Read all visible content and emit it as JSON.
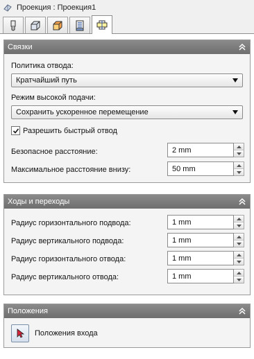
{
  "window": {
    "title": "Проекция : Проекция1"
  },
  "tabs": [
    {
      "icon": "tool-icon"
    },
    {
      "icon": "stock-box-icon"
    },
    {
      "icon": "geometry-box-icon"
    },
    {
      "icon": "heights-icon"
    },
    {
      "icon": "linking-icon",
      "active": true
    }
  ],
  "links": {
    "header": "Связки",
    "retract_policy_label": "Политика отвода:",
    "retract_policy_value": "Кратчайший путь",
    "high_feed_label": "Режим высокой подачи:",
    "high_feed_value": "Сохранить ускоренное перемещение",
    "allow_rapid_label": "Разрешить быстрый отвод",
    "allow_rapid_checked": true,
    "safe_distance_label": "Безопасное расстояние:",
    "safe_distance_value": "2 mm",
    "max_stay_down_label": "Максимальное расстояние внизу:",
    "max_stay_down_value": "50 mm"
  },
  "leads": {
    "header": "Ходы и переходы",
    "horiz_lead_in_label": "Радиус горизонтального подвода:",
    "horiz_lead_in_value": "1 mm",
    "vert_lead_in_label": "Радиус вертикального подвода:",
    "vert_lead_in_value": "1 mm",
    "horiz_lead_out_label": "Радиус горизонтального отвода:",
    "horiz_lead_out_value": "1 mm",
    "vert_lead_out_label": "Радиус вертикального отвода:",
    "vert_lead_out_value": "1 mm"
  },
  "positions": {
    "header": "Положения",
    "entry_positions_label": "Положения входа"
  },
  "colors": {
    "section_header": "#7d7d7d",
    "panel_bg": "#f4f4f4"
  }
}
